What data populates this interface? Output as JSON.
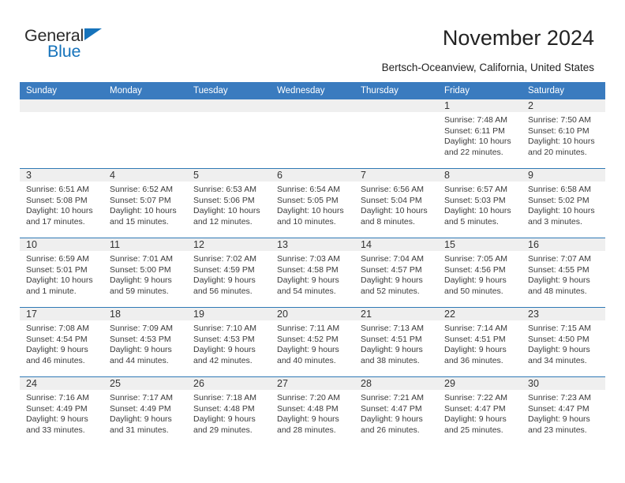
{
  "brand": {
    "name_part1": "General",
    "name_part2": "Blue",
    "accent_color": "#1673bb"
  },
  "header": {
    "title": "November 2024",
    "location": "Bertsch-Oceanview, California, United States"
  },
  "calendar": {
    "header_color": "#3a7bbf",
    "weekday_headers": [
      "Sunday",
      "Monday",
      "Tuesday",
      "Wednesday",
      "Thursday",
      "Friday",
      "Saturday"
    ],
    "weeks": [
      [
        {
          "day": "",
          "sunrise": "",
          "sunset": "",
          "daylight_line1": "",
          "daylight_line2": ""
        },
        {
          "day": "",
          "sunrise": "",
          "sunset": "",
          "daylight_line1": "",
          "daylight_line2": ""
        },
        {
          "day": "",
          "sunrise": "",
          "sunset": "",
          "daylight_line1": "",
          "daylight_line2": ""
        },
        {
          "day": "",
          "sunrise": "",
          "sunset": "",
          "daylight_line1": "",
          "daylight_line2": ""
        },
        {
          "day": "",
          "sunrise": "",
          "sunset": "",
          "daylight_line1": "",
          "daylight_line2": ""
        },
        {
          "day": "1",
          "sunrise": "Sunrise: 7:48 AM",
          "sunset": "Sunset: 6:11 PM",
          "daylight_line1": "Daylight: 10 hours",
          "daylight_line2": "and 22 minutes."
        },
        {
          "day": "2",
          "sunrise": "Sunrise: 7:50 AM",
          "sunset": "Sunset: 6:10 PM",
          "daylight_line1": "Daylight: 10 hours",
          "daylight_line2": "and 20 minutes."
        }
      ],
      [
        {
          "day": "3",
          "sunrise": "Sunrise: 6:51 AM",
          "sunset": "Sunset: 5:08 PM",
          "daylight_line1": "Daylight: 10 hours",
          "daylight_line2": "and 17 minutes."
        },
        {
          "day": "4",
          "sunrise": "Sunrise: 6:52 AM",
          "sunset": "Sunset: 5:07 PM",
          "daylight_line1": "Daylight: 10 hours",
          "daylight_line2": "and 15 minutes."
        },
        {
          "day": "5",
          "sunrise": "Sunrise: 6:53 AM",
          "sunset": "Sunset: 5:06 PM",
          "daylight_line1": "Daylight: 10 hours",
          "daylight_line2": "and 12 minutes."
        },
        {
          "day": "6",
          "sunrise": "Sunrise: 6:54 AM",
          "sunset": "Sunset: 5:05 PM",
          "daylight_line1": "Daylight: 10 hours",
          "daylight_line2": "and 10 minutes."
        },
        {
          "day": "7",
          "sunrise": "Sunrise: 6:56 AM",
          "sunset": "Sunset: 5:04 PM",
          "daylight_line1": "Daylight: 10 hours",
          "daylight_line2": "and 8 minutes."
        },
        {
          "day": "8",
          "sunrise": "Sunrise: 6:57 AM",
          "sunset": "Sunset: 5:03 PM",
          "daylight_line1": "Daylight: 10 hours",
          "daylight_line2": "and 5 minutes."
        },
        {
          "day": "9",
          "sunrise": "Sunrise: 6:58 AM",
          "sunset": "Sunset: 5:02 PM",
          "daylight_line1": "Daylight: 10 hours",
          "daylight_line2": "and 3 minutes."
        }
      ],
      [
        {
          "day": "10",
          "sunrise": "Sunrise: 6:59 AM",
          "sunset": "Sunset: 5:01 PM",
          "daylight_line1": "Daylight: 10 hours",
          "daylight_line2": "and 1 minute."
        },
        {
          "day": "11",
          "sunrise": "Sunrise: 7:01 AM",
          "sunset": "Sunset: 5:00 PM",
          "daylight_line1": "Daylight: 9 hours",
          "daylight_line2": "and 59 minutes."
        },
        {
          "day": "12",
          "sunrise": "Sunrise: 7:02 AM",
          "sunset": "Sunset: 4:59 PM",
          "daylight_line1": "Daylight: 9 hours",
          "daylight_line2": "and 56 minutes."
        },
        {
          "day": "13",
          "sunrise": "Sunrise: 7:03 AM",
          "sunset": "Sunset: 4:58 PM",
          "daylight_line1": "Daylight: 9 hours",
          "daylight_line2": "and 54 minutes."
        },
        {
          "day": "14",
          "sunrise": "Sunrise: 7:04 AM",
          "sunset": "Sunset: 4:57 PM",
          "daylight_line1": "Daylight: 9 hours",
          "daylight_line2": "and 52 minutes."
        },
        {
          "day": "15",
          "sunrise": "Sunrise: 7:05 AM",
          "sunset": "Sunset: 4:56 PM",
          "daylight_line1": "Daylight: 9 hours",
          "daylight_line2": "and 50 minutes."
        },
        {
          "day": "16",
          "sunrise": "Sunrise: 7:07 AM",
          "sunset": "Sunset: 4:55 PM",
          "daylight_line1": "Daylight: 9 hours",
          "daylight_line2": "and 48 minutes."
        }
      ],
      [
        {
          "day": "17",
          "sunrise": "Sunrise: 7:08 AM",
          "sunset": "Sunset: 4:54 PM",
          "daylight_line1": "Daylight: 9 hours",
          "daylight_line2": "and 46 minutes."
        },
        {
          "day": "18",
          "sunrise": "Sunrise: 7:09 AM",
          "sunset": "Sunset: 4:53 PM",
          "daylight_line1": "Daylight: 9 hours",
          "daylight_line2": "and 44 minutes."
        },
        {
          "day": "19",
          "sunrise": "Sunrise: 7:10 AM",
          "sunset": "Sunset: 4:53 PM",
          "daylight_line1": "Daylight: 9 hours",
          "daylight_line2": "and 42 minutes."
        },
        {
          "day": "20",
          "sunrise": "Sunrise: 7:11 AM",
          "sunset": "Sunset: 4:52 PM",
          "daylight_line1": "Daylight: 9 hours",
          "daylight_line2": "and 40 minutes."
        },
        {
          "day": "21",
          "sunrise": "Sunrise: 7:13 AM",
          "sunset": "Sunset: 4:51 PM",
          "daylight_line1": "Daylight: 9 hours",
          "daylight_line2": "and 38 minutes."
        },
        {
          "day": "22",
          "sunrise": "Sunrise: 7:14 AM",
          "sunset": "Sunset: 4:51 PM",
          "daylight_line1": "Daylight: 9 hours",
          "daylight_line2": "and 36 minutes."
        },
        {
          "day": "23",
          "sunrise": "Sunrise: 7:15 AM",
          "sunset": "Sunset: 4:50 PM",
          "daylight_line1": "Daylight: 9 hours",
          "daylight_line2": "and 34 minutes."
        }
      ],
      [
        {
          "day": "24",
          "sunrise": "Sunrise: 7:16 AM",
          "sunset": "Sunset: 4:49 PM",
          "daylight_line1": "Daylight: 9 hours",
          "daylight_line2": "and 33 minutes."
        },
        {
          "day": "25",
          "sunrise": "Sunrise: 7:17 AM",
          "sunset": "Sunset: 4:49 PM",
          "daylight_line1": "Daylight: 9 hours",
          "daylight_line2": "and 31 minutes."
        },
        {
          "day": "26",
          "sunrise": "Sunrise: 7:18 AM",
          "sunset": "Sunset: 4:48 PM",
          "daylight_line1": "Daylight: 9 hours",
          "daylight_line2": "and 29 minutes."
        },
        {
          "day": "27",
          "sunrise": "Sunrise: 7:20 AM",
          "sunset": "Sunset: 4:48 PM",
          "daylight_line1": "Daylight: 9 hours",
          "daylight_line2": "and 28 minutes."
        },
        {
          "day": "28",
          "sunrise": "Sunrise: 7:21 AM",
          "sunset": "Sunset: 4:47 PM",
          "daylight_line1": "Daylight: 9 hours",
          "daylight_line2": "and 26 minutes."
        },
        {
          "day": "29",
          "sunrise": "Sunrise: 7:22 AM",
          "sunset": "Sunset: 4:47 PM",
          "daylight_line1": "Daylight: 9 hours",
          "daylight_line2": "and 25 minutes."
        },
        {
          "day": "30",
          "sunrise": "Sunrise: 7:23 AM",
          "sunset": "Sunset: 4:47 PM",
          "daylight_line1": "Daylight: 9 hours",
          "daylight_line2": "and 23 minutes."
        }
      ]
    ]
  }
}
